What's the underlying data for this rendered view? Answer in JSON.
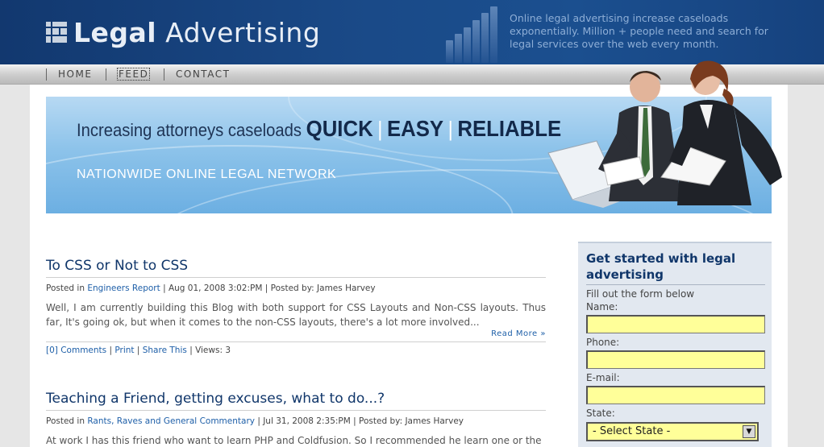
{
  "header": {
    "logo_bold": "Legal",
    "logo_thin": "Advertising",
    "tagline": "Online legal advertising increase caseloads exponentially. Million + people need and search for legal services over the web every month."
  },
  "nav": {
    "items": [
      {
        "label": "HOME"
      },
      {
        "label": "FEED"
      },
      {
        "label": "CONTACT"
      }
    ]
  },
  "banner": {
    "lead": "Increasing attorneys caseloads",
    "w1": "QUICK",
    "w2": "EASY",
    "w3": "RELIABLE",
    "sub": "NATIONWIDE ONLINE LEGAL NETWORK"
  },
  "posts": [
    {
      "title": "To CSS or Not to CSS",
      "posted_in_label": "Posted in",
      "category": "Engineers Report",
      "meta_rest": "| Aug 01, 2008 3:02:PM | Posted by: James Harvey",
      "body": "Well, I am currently building this Blog with both support for CSS Layouts and Non-CSS layouts. Thus far, It's going ok, but when it comes to the non-CSS layouts, there's a lot more involved...",
      "read_more": "Read More »",
      "comments": "[0] Comments",
      "print": "Print",
      "share": "Share This",
      "views": "| Views: 3"
    },
    {
      "title": "Teaching a Friend, getting excuses, what to do...?",
      "posted_in_label": "Posted in",
      "category": "Rants, Raves and General Commentary",
      "meta_rest": "| Jul 31, 2008 2:35:PM | Posted by: James Harvey",
      "body": "At work I has this friend who want to learn PHP and Coldfusion. So I recommended he learn one or the"
    }
  ],
  "sidebar": {
    "title": "Get started with legal advertising",
    "intro": "Fill out the form below",
    "name_label": "Name:",
    "phone_label": "Phone:",
    "email_label": "E-mail:",
    "state_label": "State:",
    "state_value": "- Select State -",
    "name_value": "",
    "phone_value": "",
    "email_value": ""
  },
  "colors": {
    "header": "#1a4a88",
    "link": "#1e5fa8",
    "title": "#10366a",
    "input_bg": "#ffff99"
  }
}
